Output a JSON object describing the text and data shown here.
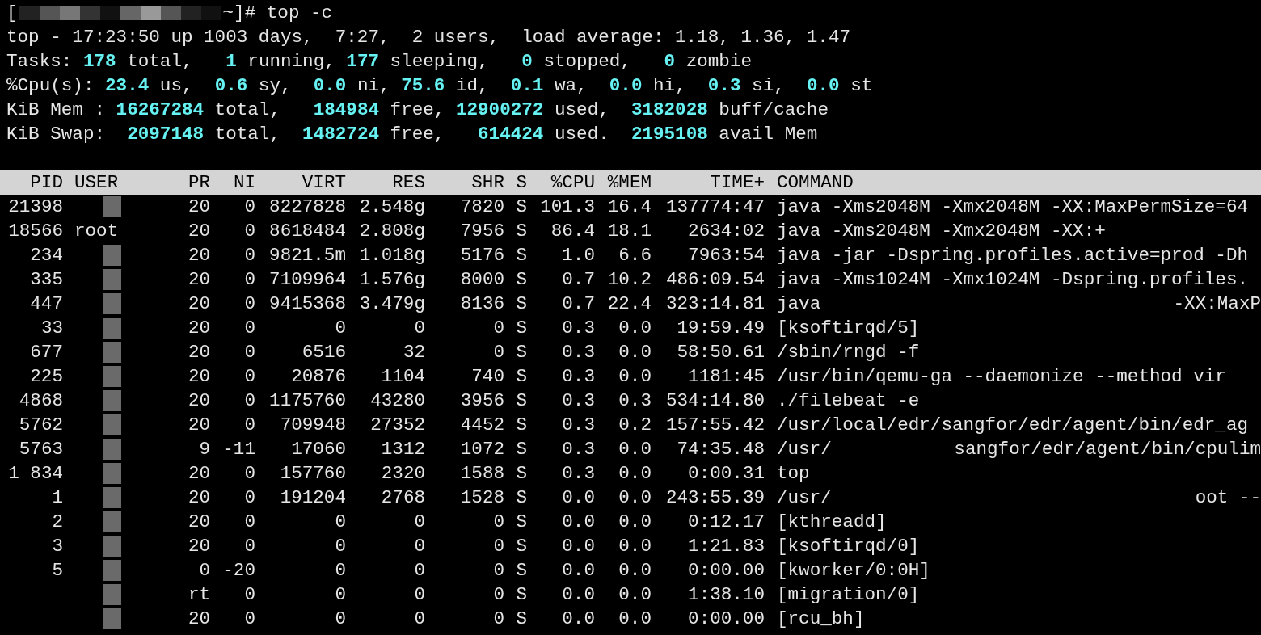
{
  "prompt": {
    "prefix": "[",
    "command": "~]# top -c"
  },
  "summary": [
    [
      {
        "kind": "label",
        "text": "top - 17:23:50 up 1003 days,  7:27,  2 users,  load average: 1.18, 1.36, 1.47"
      }
    ],
    [
      {
        "kind": "label",
        "text": "Tasks: "
      },
      {
        "kind": "value",
        "text": "178"
      },
      {
        "kind": "label",
        "text": " total,   "
      },
      {
        "kind": "value",
        "text": "1"
      },
      {
        "kind": "label",
        "text": " running, "
      },
      {
        "kind": "value",
        "text": "177"
      },
      {
        "kind": "label",
        "text": " sleeping,   "
      },
      {
        "kind": "value",
        "text": "0"
      },
      {
        "kind": "label",
        "text": " stopped,   "
      },
      {
        "kind": "value",
        "text": "0"
      },
      {
        "kind": "label",
        "text": " zombie"
      }
    ],
    [
      {
        "kind": "label",
        "text": "%Cpu(s): "
      },
      {
        "kind": "value",
        "text": "23.4"
      },
      {
        "kind": "label",
        "text": " us,  "
      },
      {
        "kind": "value",
        "text": "0.6"
      },
      {
        "kind": "label",
        "text": " sy,  "
      },
      {
        "kind": "value",
        "text": "0.0"
      },
      {
        "kind": "label",
        "text": " ni, "
      },
      {
        "kind": "value",
        "text": "75.6"
      },
      {
        "kind": "label",
        "text": " id,  "
      },
      {
        "kind": "value",
        "text": "0.1"
      },
      {
        "kind": "label",
        "text": " wa,  "
      },
      {
        "kind": "value",
        "text": "0.0"
      },
      {
        "kind": "label",
        "text": " hi,  "
      },
      {
        "kind": "value",
        "text": "0.3"
      },
      {
        "kind": "label",
        "text": " si,  "
      },
      {
        "kind": "value",
        "text": "0.0"
      },
      {
        "kind": "label",
        "text": " st"
      }
    ],
    [
      {
        "kind": "label",
        "text": "KiB Mem : "
      },
      {
        "kind": "value",
        "text": "16267284"
      },
      {
        "kind": "label",
        "text": " total,   "
      },
      {
        "kind": "value",
        "text": "184984"
      },
      {
        "kind": "label",
        "text": " free, "
      },
      {
        "kind": "value",
        "text": "12900272"
      },
      {
        "kind": "label",
        "text": " used,  "
      },
      {
        "kind": "value",
        "text": "3182028"
      },
      {
        "kind": "label",
        "text": " buff/cache"
      }
    ],
    [
      {
        "kind": "label",
        "text": "KiB Swap:  "
      },
      {
        "kind": "value",
        "text": "2097148"
      },
      {
        "kind": "label",
        "text": " total,  "
      },
      {
        "kind": "value",
        "text": "1482724"
      },
      {
        "kind": "label",
        "text": " free,   "
      },
      {
        "kind": "value",
        "text": "614424"
      },
      {
        "kind": "label",
        "text": " used.  "
      },
      {
        "kind": "value",
        "text": "2195108"
      },
      {
        "kind": "label",
        "text": " avail Mem"
      }
    ]
  ],
  "table": {
    "columns": [
      "PID",
      "USER",
      "PR",
      "NI",
      "VIRT",
      "RES",
      "SHR",
      "S",
      "%CPU",
      "%MEM",
      "TIME+",
      "COMMAND"
    ],
    "rows": [
      {
        "pid": "21398",
        "pr": "20",
        "ni": "0",
        "virt": "8227828",
        "res": "2.548g",
        "shr": "7820",
        "s": "S",
        "cpu": "101.3",
        "mem": "16.4",
        "time": "137774:47",
        "command": "java -Xms2048M -Xmx2048M -XX:MaxPermSize=64"
      },
      {
        "pid": "18566",
        "user": "root",
        "pr": "20",
        "ni": "0",
        "virt": "8618484",
        "res": "2.808g",
        "shr": "7956",
        "s": "S",
        "cpu": "86.4",
        "mem": "18.1",
        "time": "2634:02",
        "command": "java -Xms2048M -Xmx2048M -XX:+"
      },
      {
        "pid": "234",
        "pr": "20",
        "ni": "0",
        "virt": "9821.5m",
        "res": "1.018g",
        "shr": "5176",
        "s": "S",
        "cpu": "1.0",
        "mem": "6.6",
        "time": "7963:54",
        "command": "java -jar -Dspring.profiles.active=prod -Dh"
      },
      {
        "pid": "335",
        "pr": "20",
        "ni": "0",
        "virt": "7109964",
        "res": "1.576g",
        "shr": "8000",
        "s": "S",
        "cpu": "0.7",
        "mem": "10.2",
        "time": "486:09.54",
        "command": "java -Xms1024M -Xmx1024M -Dspring.profiles."
      },
      {
        "pid": "447",
        "pr": "20",
        "ni": "0",
        "virt": "9415368",
        "res": "3.479g",
        "shr": "8136",
        "s": "S",
        "cpu": "0.7",
        "mem": "22.4",
        "time": "323:14.81",
        "command": "java",
        "command_tail": "-XX:MaxP"
      },
      {
        "pid": "33",
        "pr": "20",
        "ni": "0",
        "virt": "0",
        "res": "0",
        "shr": "0",
        "s": "S",
        "cpu": "0.3",
        "mem": "0.0",
        "time": "19:59.49",
        "command": "[ksoftirqd/5]"
      },
      {
        "pid": "677",
        "pr": "20",
        "ni": "0",
        "virt": "6516",
        "res": "32",
        "shr": "0",
        "s": "S",
        "cpu": "0.3",
        "mem": "0.0",
        "time": "58:50.61",
        "command": "/sbin/rngd -f"
      },
      {
        "pid": "225",
        "pr": "20",
        "ni": "0",
        "virt": "20876",
        "res": "1104",
        "shr": "740",
        "s": "S",
        "cpu": "0.3",
        "mem": "0.0",
        "time": "1181:45",
        "command": "/usr/bin/qemu-ga --daemonize --method vir"
      },
      {
        "pid": "4868",
        "pr": "20",
        "ni": "0",
        "virt": "1175760",
        "res": "43280",
        "shr": "3956",
        "s": "S",
        "cpu": "0.3",
        "mem": "0.3",
        "time": "534:14.80",
        "command": "./filebeat -e"
      },
      {
        "pid": "5762",
        "pr": "20",
        "ni": "0",
        "virt": "709948",
        "res": "27352",
        "shr": "4452",
        "s": "S",
        "cpu": "0.3",
        "mem": "0.2",
        "time": "157:55.42",
        "command": "/usr/local/edr/sangfor/edr/agent/bin/edr_ag"
      },
      {
        "pid": "5763",
        "pr": "9",
        "ni": "-11",
        "virt": "17060",
        "res": "1312",
        "shr": "1072",
        "s": "S",
        "cpu": "0.3",
        "mem": "0.0",
        "time": "74:35.48",
        "command": "/usr/",
        "command_tail": "sangfor/edr/agent/bin/cpulim"
      },
      {
        "pid": "1 834",
        "pr": "20",
        "ni": "0",
        "virt": "157760",
        "res": "2320",
        "shr": "1588",
        "s": "S",
        "cpu": "0.3",
        "mem": "0.0",
        "time": "0:00.31",
        "command": "top"
      },
      {
        "pid": "1",
        "pr": "20",
        "ni": "0",
        "virt": "191204",
        "res": "2768",
        "shr": "1528",
        "s": "S",
        "cpu": "0.0",
        "mem": "0.0",
        "time": "243:55.39",
        "command": "/usr/",
        "command_tail": "oot --"
      },
      {
        "pid": "2",
        "pr": "20",
        "ni": "0",
        "virt": "0",
        "res": "0",
        "shr": "0",
        "s": "S",
        "cpu": "0.0",
        "mem": "0.0",
        "time": "0:12.17",
        "command": "[kthreadd]"
      },
      {
        "pid": "3",
        "pr": "20",
        "ni": "0",
        "virt": "0",
        "res": "0",
        "shr": "0",
        "s": "S",
        "cpu": "0.0",
        "mem": "0.0",
        "time": "1:21.83",
        "command": "[ksoftirqd/0]"
      },
      {
        "pid": "5",
        "pr": "0",
        "ni": "-20",
        "virt": "0",
        "res": "0",
        "shr": "0",
        "s": "S",
        "cpu": "0.0",
        "mem": "0.0",
        "time": "0:00.00",
        "command": "[kworker/0:0H]"
      },
      {
        "pr": "rt",
        "ni": "0",
        "virt": "0",
        "res": "0",
        "shr": "0",
        "s": "S",
        "cpu": "0.0",
        "mem": "0.0",
        "time": "1:38.10",
        "command": "[migration/0]"
      },
      {
        "pr": "20",
        "ni": "0",
        "virt": "0",
        "res": "0",
        "shr": "0",
        "s": "S",
        "cpu": "0.0",
        "mem": "0.0",
        "time": "0:00.00",
        "command": "[rcu_bh]"
      }
    ]
  }
}
